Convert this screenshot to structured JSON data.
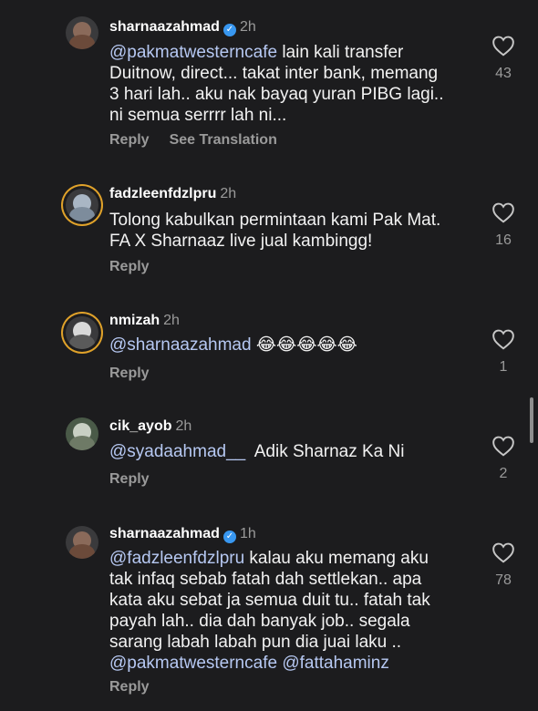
{
  "comments": [
    {
      "username": "sharnaazahmad",
      "verified": true,
      "time": "2h",
      "lines": [
        [
          {
            "t": "@pakmatwesterncafe",
            "m": true
          },
          {
            "t": " lain kali transfer",
            "m": false
          }
        ],
        [
          {
            "t": "Duitnow, direct... takat inter bank, memang",
            "m": false
          }
        ],
        [
          {
            "t": "3 hari lah.. aku nak bayaq yuran PIBG lagi..",
            "m": false
          }
        ],
        [
          {
            "t": "ni semua serrrr lah ni...",
            "m": false
          }
        ]
      ],
      "reply_label": "Reply",
      "see_translation_label": "See Translation",
      "likes": "43"
    },
    {
      "username": "fadzleenfdzlpru",
      "verified": false,
      "time": "2h",
      "lines": [
        [
          {
            "t": "Tolong kabulkan permintaan kami Pak Mat.",
            "m": false
          }
        ],
        [
          {
            "t": "FA X Sharnaaz live jual kambingg!",
            "m": false
          }
        ]
      ],
      "reply_label": "Reply",
      "likes": "16"
    },
    {
      "username": "nmizah",
      "verified": false,
      "time": "2h",
      "lines": [
        [
          {
            "t": "@sharnaazahmad",
            "m": true
          },
          {
            "t": " 😂😂😂😂😂",
            "m": false
          }
        ]
      ],
      "reply_label": "Reply",
      "likes": "1"
    },
    {
      "username": "cik_ayob",
      "verified": false,
      "time": "2h",
      "lines": [
        [
          {
            "t": "@syadaahmad__",
            "m": true
          },
          {
            "t": "  Adik Sharnaz Ka Ni",
            "m": false
          }
        ]
      ],
      "reply_label": "Reply",
      "likes": "2"
    },
    {
      "username": "sharnaazahmad",
      "verified": true,
      "time": "1h",
      "lines": [
        [
          {
            "t": "@fadzleenfdzlpru",
            "m": true
          },
          {
            "t": " kalau aku memang aku",
            "m": false
          }
        ],
        [
          {
            "t": "tak infaq sebab fatah dah settlekan.. apa",
            "m": false
          }
        ],
        [
          {
            "t": "kata aku sebat ja semua duit tu.. fatah tak",
            "m": false
          }
        ],
        [
          {
            "t": "payah lah.. dia dah banyak job.. segala",
            "m": false
          }
        ],
        [
          {
            "t": "sarang labah labah pun dia juai laku ..",
            "m": false
          }
        ],
        [
          {
            "t": "@pakmatwesterncafe",
            "m": true
          },
          {
            "t": " ",
            "m": false
          },
          {
            "t": "@fattahaminz",
            "m": true
          }
        ]
      ],
      "reply_label": "Reply",
      "likes": "78"
    }
  ]
}
